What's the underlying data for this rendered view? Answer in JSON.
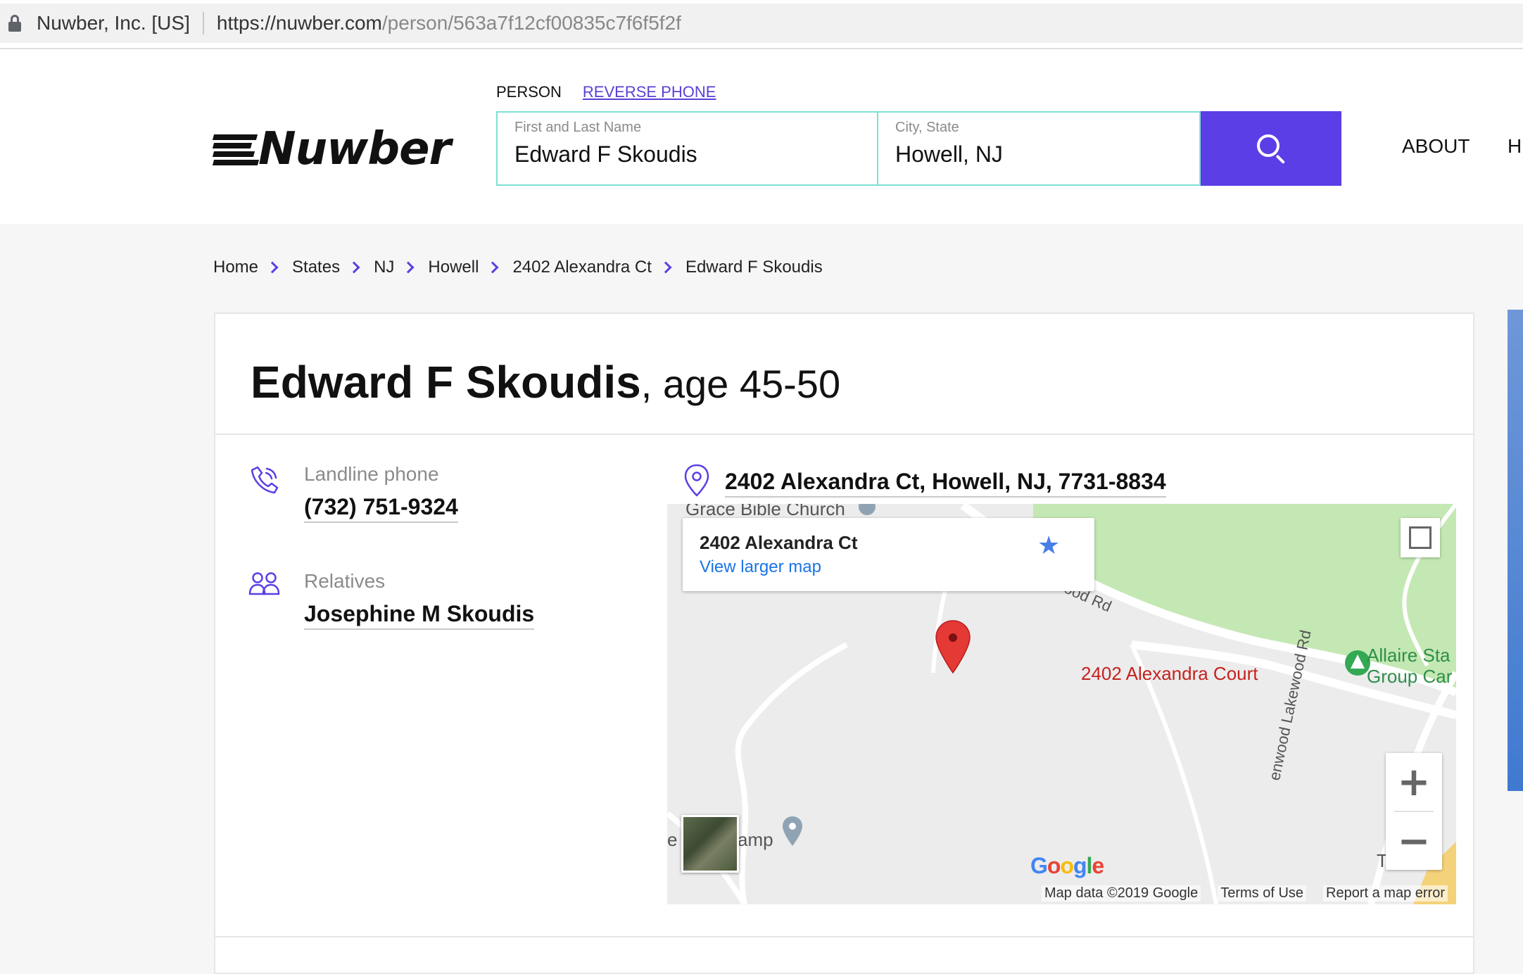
{
  "browser": {
    "site_identity": "Nuwber, Inc. [US]",
    "url_domain": "https://nuwber.com",
    "url_path": "/person/563a7f12cf00835c7f6f5f2f"
  },
  "header": {
    "logo_text": "Nuwber",
    "tabs": {
      "person": "PERSON",
      "reverse_phone": "REVERSE PHONE"
    },
    "search": {
      "name_placeholder": "First and Last Name",
      "name_value": "Edward F Skoudis",
      "city_placeholder": "City, State",
      "city_value": "Howell, NJ"
    },
    "nav": {
      "about": "ABOUT",
      "next": "H"
    }
  },
  "breadcrumb": [
    "Home",
    "States",
    "NJ",
    "Howell",
    "2402 Alexandra Ct",
    "Edward F Skoudis"
  ],
  "person": {
    "name": "Edward F Skoudis",
    "age_text": ", age 45-50",
    "landline_label": "Landline phone",
    "landline_value": "(732) 751-9324",
    "relatives_label": "Relatives",
    "relatives_value": "Josephine M Skoudis",
    "address": "2402 Alexandra Ct, Howell, NJ, 7731-8834"
  },
  "map": {
    "card_title": "2402 Alexandra Ct",
    "card_link": "View larger map",
    "marker_label": "2402 Alexandra Court",
    "park_label_1": "Allaire Sta",
    "park_label_2": "Group Car",
    "church_label": "Grace Bible Church",
    "camp_label": "amp",
    "e_label": "e",
    "tb_label": "T        Bil",
    "road_1": "ood Rd",
    "road_2": "enwood Lakewood Rd",
    "google": "Google",
    "footer_data": "Map data ©2019 Google",
    "footer_terms": "Terms of Use",
    "footer_report": "Report a map error",
    "zoom_in": "+",
    "zoom_out": "−"
  },
  "colors": {
    "accent": "#5b3ee6",
    "field_border": "#7fe0d3",
    "link": "#1a73e8",
    "marker": "#e53935",
    "park": "#c4e8b3"
  }
}
